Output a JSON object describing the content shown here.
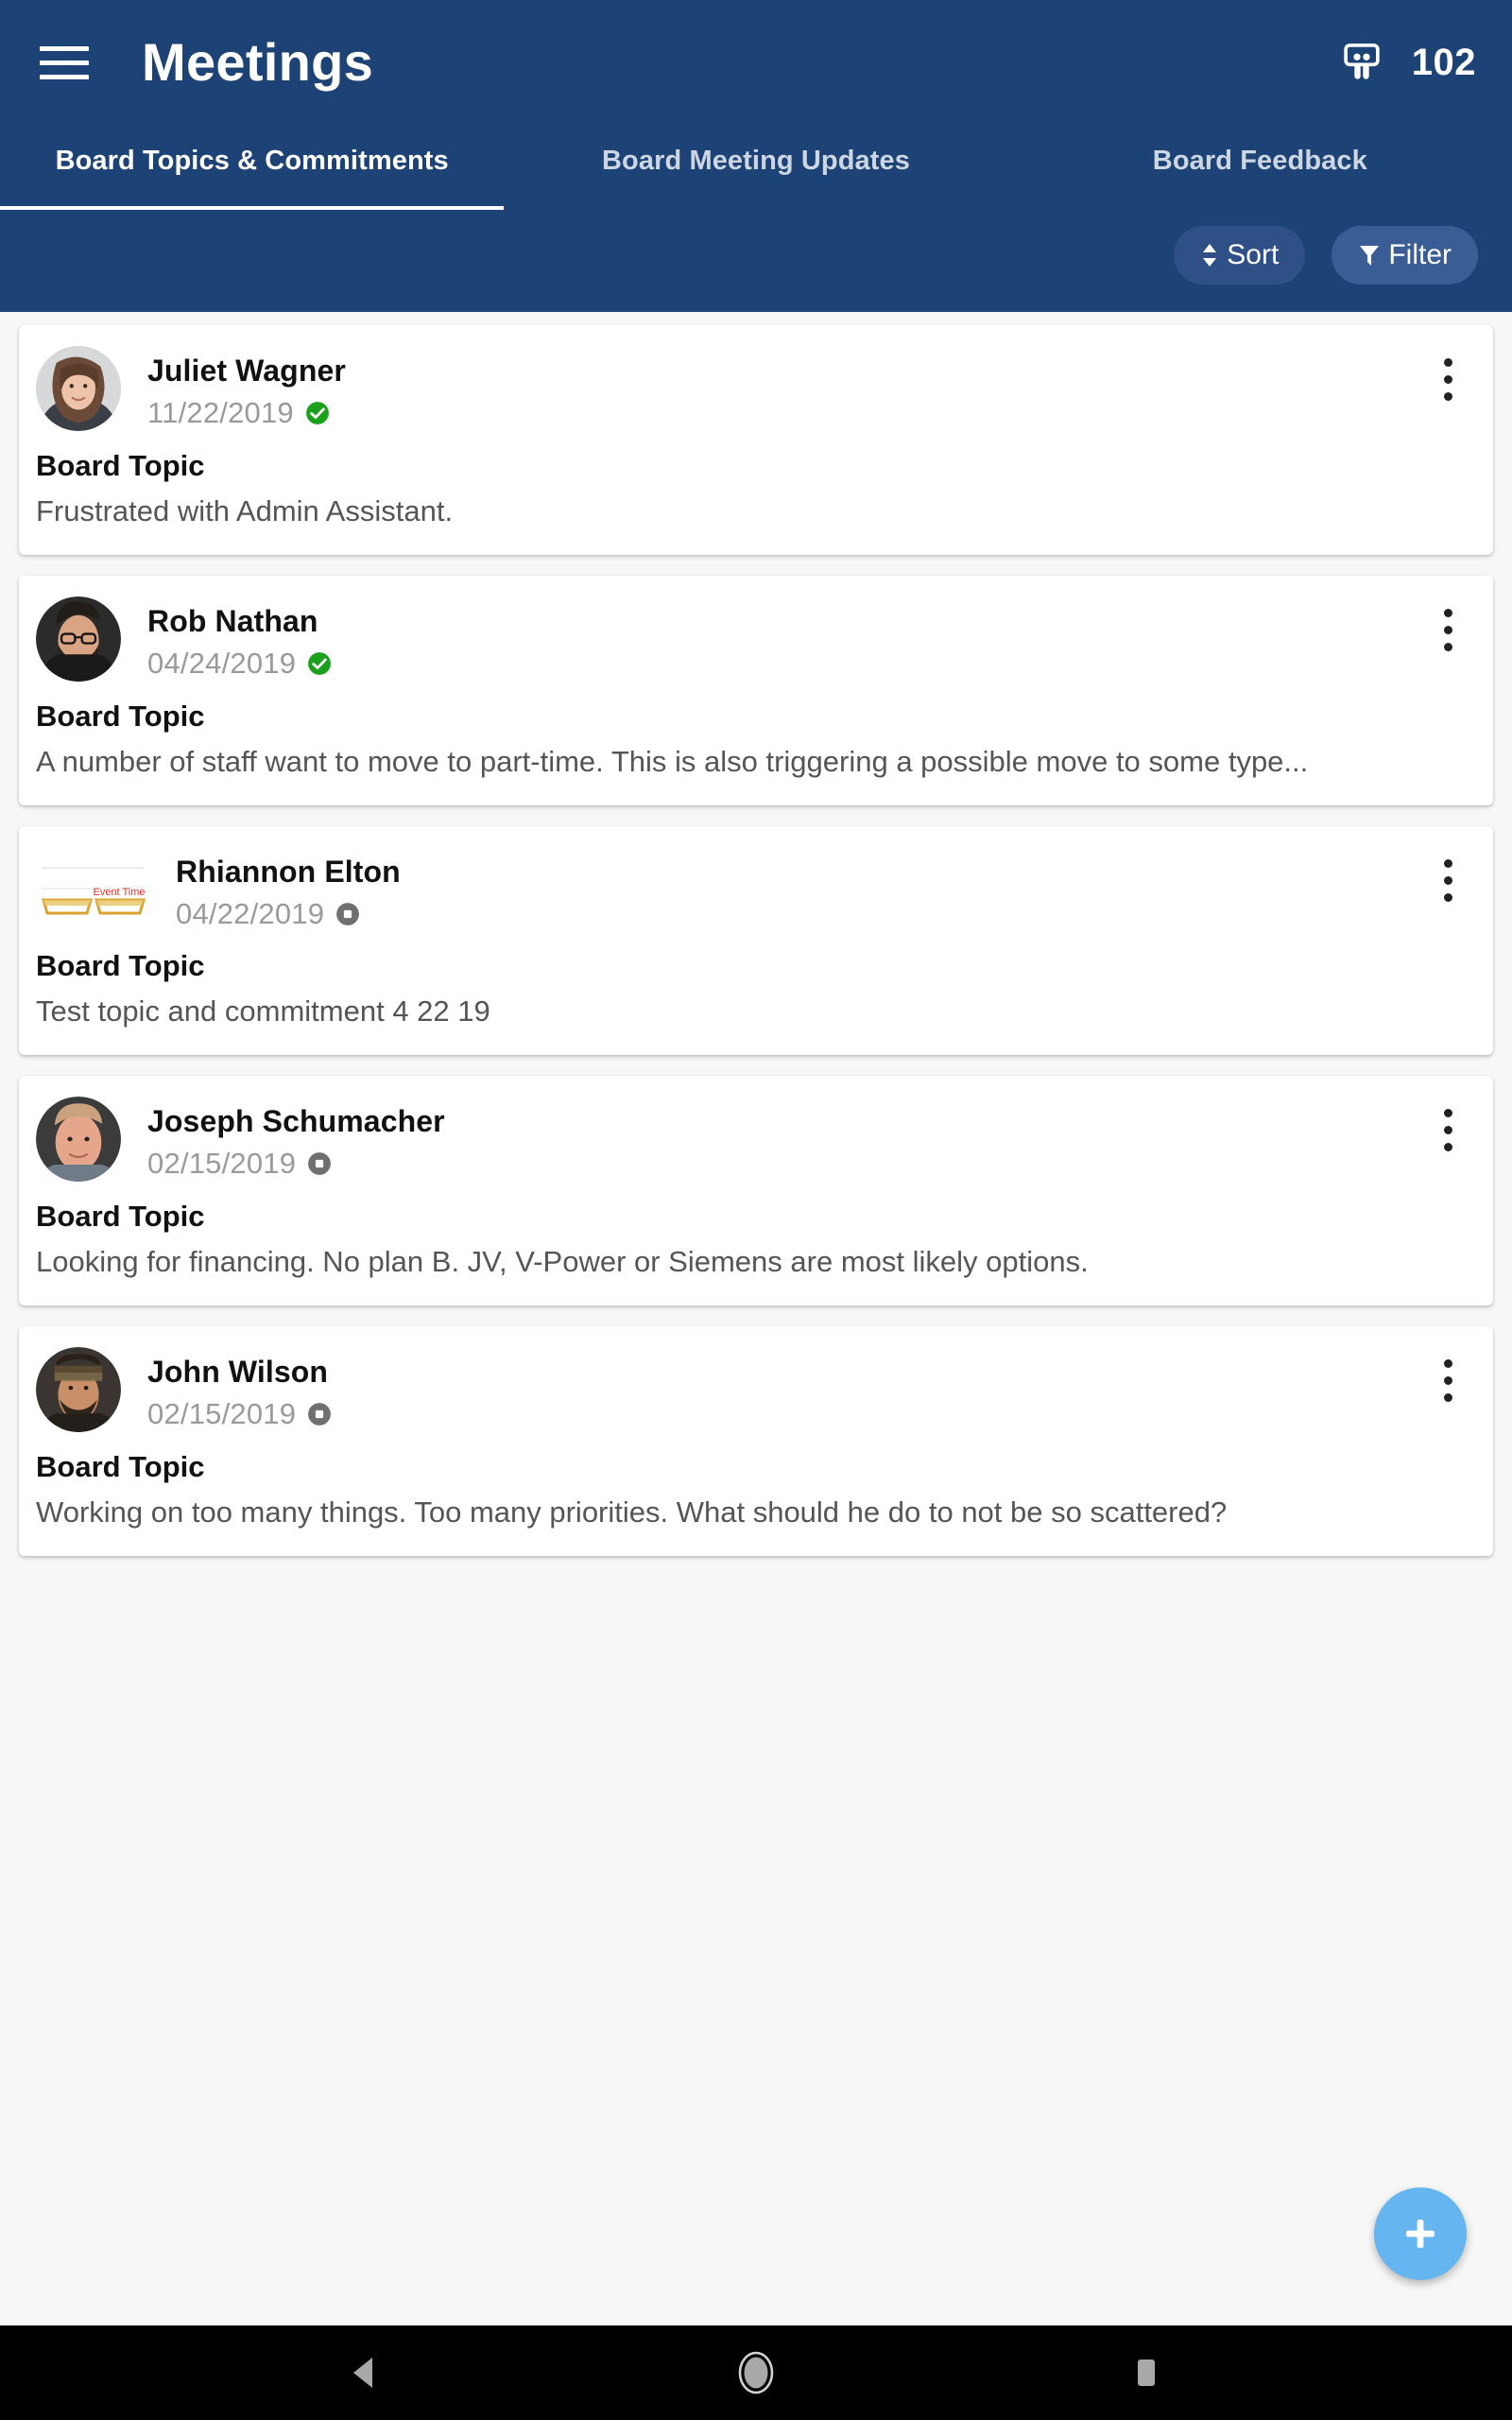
{
  "appbar": {
    "menu_icon": "hamburger-menu-icon",
    "title": "Meetings",
    "board_icon": "board-presentation-icon",
    "count": "102"
  },
  "tabs": [
    {
      "label": "Board Topics & Commitments",
      "active": true
    },
    {
      "label": "Board Meeting Updates",
      "active": false
    },
    {
      "label": "Board Feedback",
      "active": false
    }
  ],
  "controls": {
    "sort_label": "Sort",
    "sort_icon": "sort-updown-icon",
    "filter_label": "Filter",
    "filter_icon": "funnel-filter-icon"
  },
  "cards": [
    {
      "name": "Juliet Wagner",
      "date": "11/22/2019",
      "status": "approved",
      "status_icon": "green-check-circle-icon",
      "label": "Board Topic",
      "body": "Frustrated with Admin Assistant.",
      "avatar_type": "photo",
      "avatar_alt": "juliet-wagner-avatar",
      "menu_icon": "kebab-menu-icon"
    },
    {
      "name": "Rob Nathan",
      "date": "04/24/2019",
      "status": "approved",
      "status_icon": "green-check-circle-icon",
      "label": "Board Topic",
      "body": "A number of staff want to move to part-time. This is also triggering a possible move to some type...",
      "avatar_type": "photo",
      "avatar_alt": "rob-nathan-avatar",
      "menu_icon": "kebab-menu-icon"
    },
    {
      "name": "Rhiannon Elton",
      "date": "04/22/2019",
      "status": "draft",
      "status_icon": "gray-stop-circle-icon",
      "label": "Board Topic",
      "body": "Test topic and commitment 4 22 19",
      "avatar_type": "logo",
      "avatar_alt": "event-time-logo-avatar",
      "avatar_logo_text": "Event Time",
      "menu_icon": "kebab-menu-icon"
    },
    {
      "name": "Joseph Schumacher",
      "date": "02/15/2019",
      "status": "draft",
      "status_icon": "gray-stop-circle-icon",
      "label": "Board Topic",
      "body": "Looking for financing. No plan B. JV, V-Power or Siemens are most likely options.",
      "avatar_type": "photo",
      "avatar_alt": "joseph-schumacher-avatar",
      "menu_icon": "kebab-menu-icon"
    },
    {
      "name": "John Wilson",
      "date": "02/15/2019",
      "status": "draft",
      "status_icon": "gray-stop-circle-icon",
      "label": "Board Topic",
      "body": "Working on too many things. Too many priorities. What should he do to not be so scattered?",
      "avatar_type": "photo",
      "avatar_alt": "john-wilson-avatar",
      "menu_icon": "kebab-menu-icon"
    }
  ],
  "fab": {
    "icon": "plus-icon",
    "label": "+"
  },
  "navbar": {
    "back_icon": "android-back-triangle-icon",
    "home_icon": "android-home-circle-icon",
    "recents_icon": "android-recents-square-icon"
  },
  "colors": {
    "appbar_bg": "#1d4275",
    "page_bg": "#f7f7f7",
    "card_bg": "#ffffff",
    "approved_green": "#1aa01a",
    "draft_gray": "#6f6f6f",
    "fab_blue": "#64b5f0",
    "navbar_bg": "#000000",
    "muted_text": "#9a9a9a",
    "body_text": "#555555"
  }
}
